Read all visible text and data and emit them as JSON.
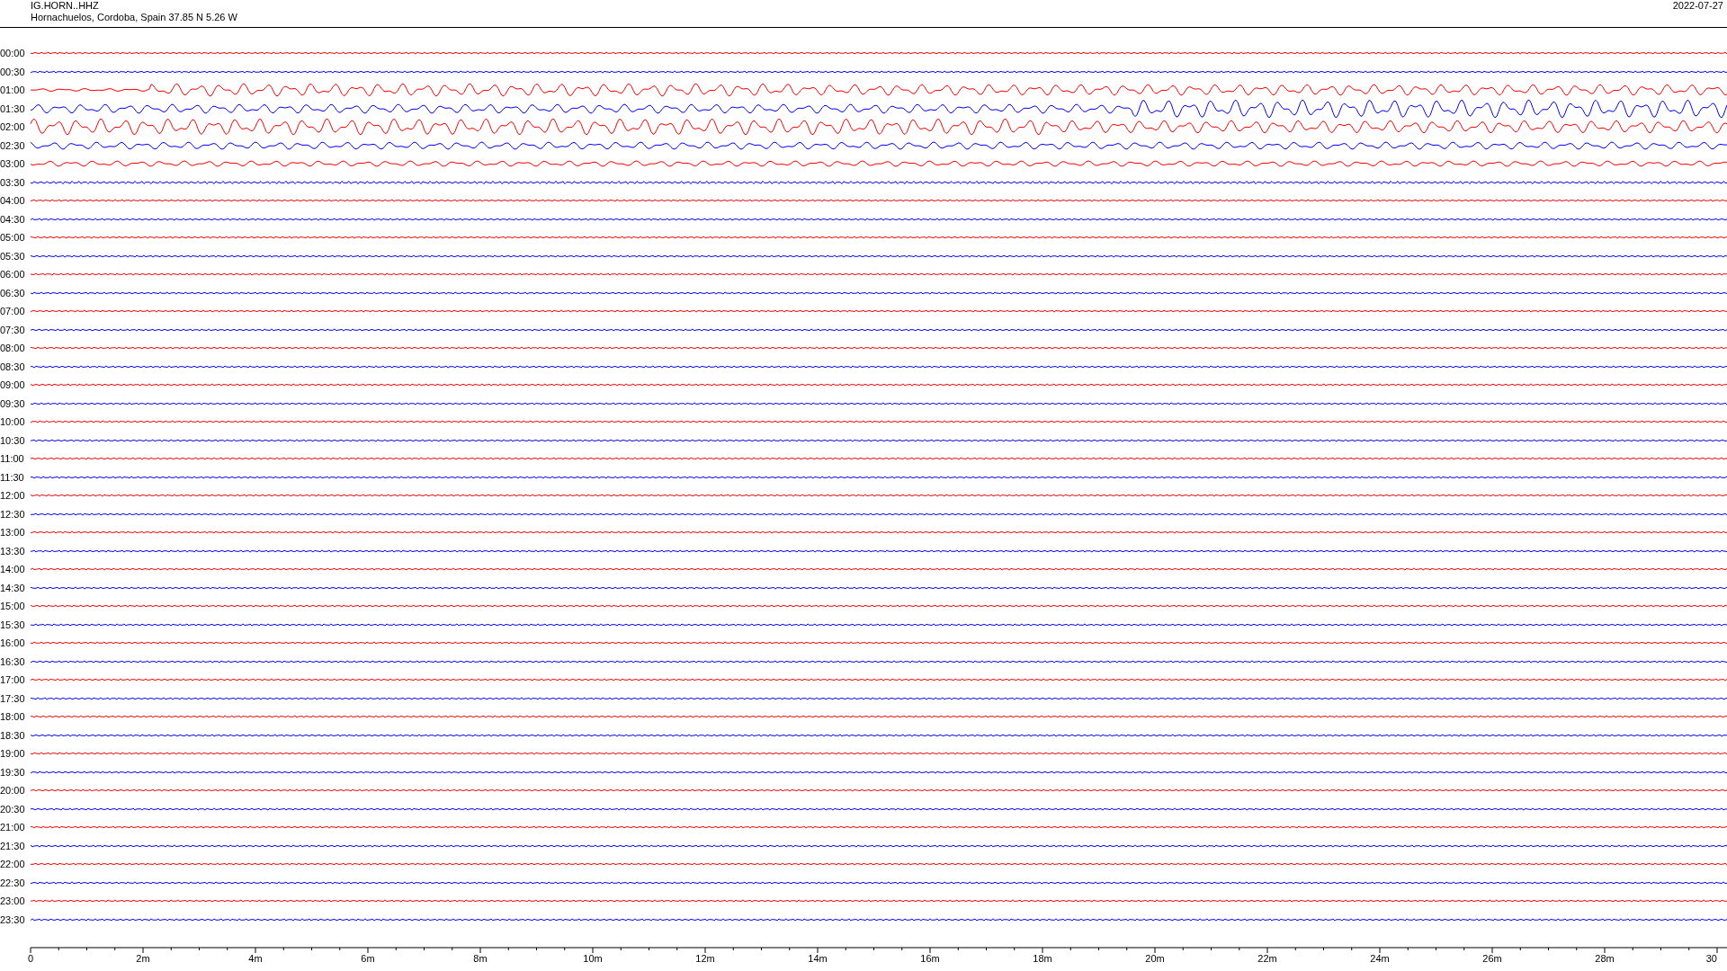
{
  "header": {
    "station": "IG.HORN..HHZ",
    "location": "Hornachuelos, Cordoba, Spain  37.85 N 5.26 W",
    "date": "2022-07-27"
  },
  "rows": [
    {
      "time": "00:00",
      "color": "#ff0000"
    },
    {
      "time": "00:30",
      "color": "#0000ff"
    },
    {
      "time": "01:00",
      "color": "#ff0000"
    },
    {
      "time": "01:30",
      "color": "#0000ff"
    },
    {
      "time": "02:00",
      "color": "#ff0000"
    },
    {
      "time": "02:30",
      "color": "#0000ff"
    },
    {
      "time": "03:00",
      "color": "#ff0000"
    },
    {
      "time": "03:30",
      "color": "#0000ff"
    },
    {
      "time": "04:00",
      "color": "#ff0000"
    },
    {
      "time": "04:30",
      "color": "#0000ff"
    },
    {
      "time": "05:00",
      "color": "#ff0000"
    },
    {
      "time": "05:30",
      "color": "#0000ff"
    },
    {
      "time": "06:00",
      "color": "#ff0000"
    },
    {
      "time": "06:30",
      "color": "#0000ff"
    },
    {
      "time": "07:00",
      "color": "#ff0000"
    },
    {
      "time": "07:30",
      "color": "#0000ff"
    },
    {
      "time": "08:00",
      "color": "#ff0000"
    },
    {
      "time": "08:30",
      "color": "#0000ff"
    },
    {
      "time": "09:00",
      "color": "#ff0000"
    },
    {
      "time": "09:30",
      "color": "#0000ff"
    },
    {
      "time": "10:00",
      "color": "#ff0000"
    },
    {
      "time": "10:30",
      "color": "#0000ff"
    },
    {
      "time": "11:00",
      "color": "#ff0000"
    },
    {
      "time": "11:30",
      "color": "#0000ff"
    },
    {
      "time": "12:00",
      "color": "#ff0000"
    },
    {
      "time": "12:30",
      "color": "#0000ff"
    },
    {
      "time": "13:00",
      "color": "#ff0000"
    },
    {
      "time": "13:30",
      "color": "#0000ff"
    },
    {
      "time": "14:00",
      "color": "#ff0000"
    },
    {
      "time": "14:30",
      "color": "#0000ff"
    },
    {
      "time": "15:00",
      "color": "#ff0000"
    },
    {
      "time": "15:30",
      "color": "#0000ff"
    },
    {
      "time": "16:00",
      "color": "#ff0000"
    },
    {
      "time": "16:30",
      "color": "#0000ff"
    },
    {
      "time": "17:00",
      "color": "#ff0000"
    },
    {
      "time": "17:30",
      "color": "#0000ff"
    },
    {
      "time": "18:00",
      "color": "#ff0000"
    },
    {
      "time": "18:30",
      "color": "#0000ff"
    },
    {
      "time": "19:00",
      "color": "#ff0000"
    },
    {
      "time": "19:30",
      "color": "#0000ff"
    },
    {
      "time": "20:00",
      "color": "#ff0000"
    },
    {
      "time": "20:30",
      "color": "#0000ff"
    },
    {
      "time": "21:00",
      "color": "#ff0000"
    },
    {
      "time": "21:30",
      "color": "#0000ff"
    },
    {
      "time": "22:00",
      "color": "#ff0000"
    },
    {
      "time": "22:30",
      "color": "#0000ff"
    },
    {
      "time": "23:00",
      "color": "#ff0000"
    },
    {
      "time": "23:30",
      "color": "#0000ff"
    }
  ],
  "x_axis": {
    "ticks": [
      "0",
      "2m",
      "4m",
      "6m",
      "8m",
      "10m",
      "12m",
      "14m",
      "16m",
      "18m",
      "20m",
      "22m",
      "24m",
      "26m",
      "28m",
      "30"
    ]
  }
}
